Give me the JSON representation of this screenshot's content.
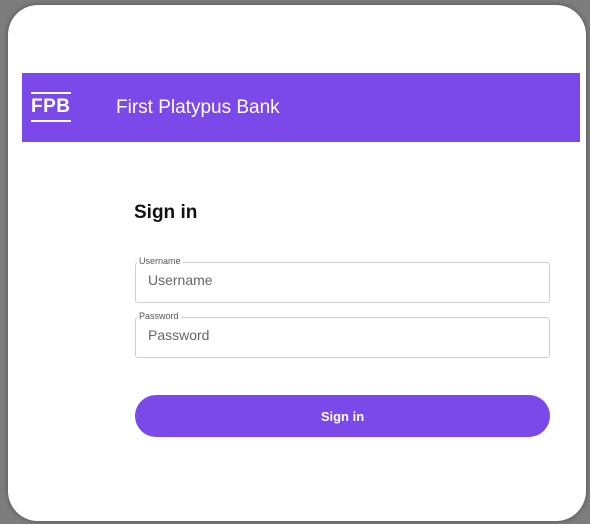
{
  "header": {
    "logo_text": "FPB",
    "bank_name": "First Platypus Bank",
    "color": "#7b49e9"
  },
  "form": {
    "title": "Sign in",
    "username": {
      "label": "Username",
      "placeholder": "Username",
      "value": ""
    },
    "password": {
      "label": "Password",
      "placeholder": "Password",
      "value": ""
    },
    "submit_label": "Sign in"
  }
}
